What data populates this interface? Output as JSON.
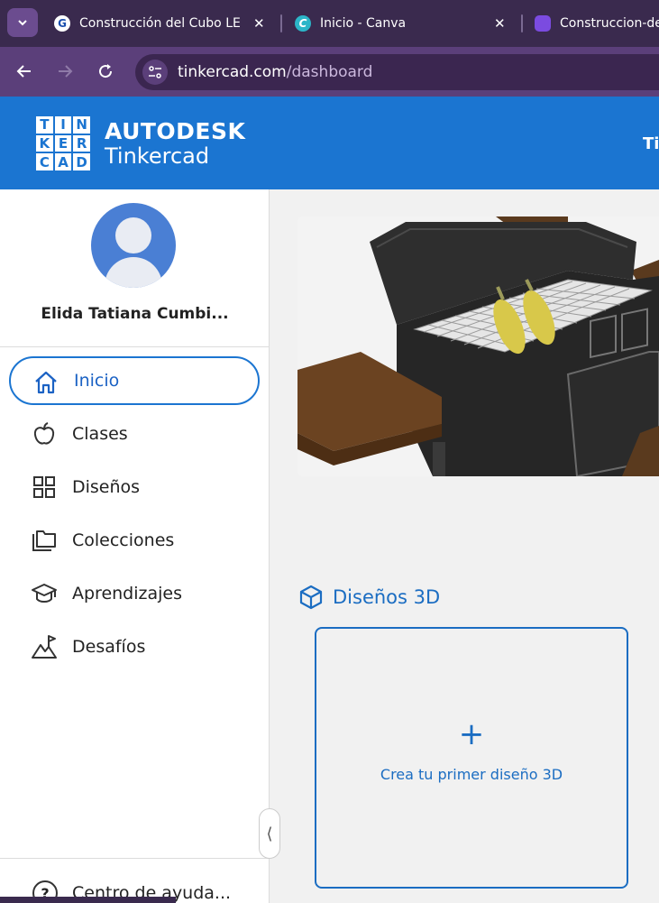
{
  "browser": {
    "tabs": [
      {
        "title": "Construcción del Cubo LED",
        "favicon": "G"
      },
      {
        "title": "Inicio - Canva",
        "favicon": "C"
      },
      {
        "title": "Construccion-de",
        "favicon": ""
      }
    ],
    "url_domain": "tinkercad.com",
    "url_path": "/dashboard"
  },
  "header": {
    "logo_letters": [
      "T",
      "I",
      "N",
      "K",
      "E",
      "R",
      "C",
      "A",
      "D"
    ],
    "brand_line1": "AUTODESK",
    "brand_line2": "Tinkercad",
    "right_text": "Ti"
  },
  "sidebar": {
    "user_name": "Elida Tatiana Cumbi...",
    "items": [
      {
        "label": "Inicio",
        "icon": "home-icon",
        "active": true
      },
      {
        "label": "Clases",
        "icon": "apple-icon",
        "active": false
      },
      {
        "label": "Diseños",
        "icon": "grid-icon",
        "active": false
      },
      {
        "label": "Colecciones",
        "icon": "folder-icon",
        "active": false
      },
      {
        "label": "Aprendizajes",
        "icon": "graduation-cap-icon",
        "active": false
      },
      {
        "label": "Desafíos",
        "icon": "mountain-flag-icon",
        "active": false
      }
    ],
    "help_label": "Centro de ayuda...",
    "collapse_glyph": "⟨"
  },
  "main": {
    "section_title": "Diseños 3D",
    "create_plus": "+",
    "create_label": "Crea tu primer diseño 3D"
  },
  "colors": {
    "brand_blue": "#1b75d1",
    "chrome_purple": "#5b3f7a",
    "tab_bar": "#3a2a4e"
  }
}
